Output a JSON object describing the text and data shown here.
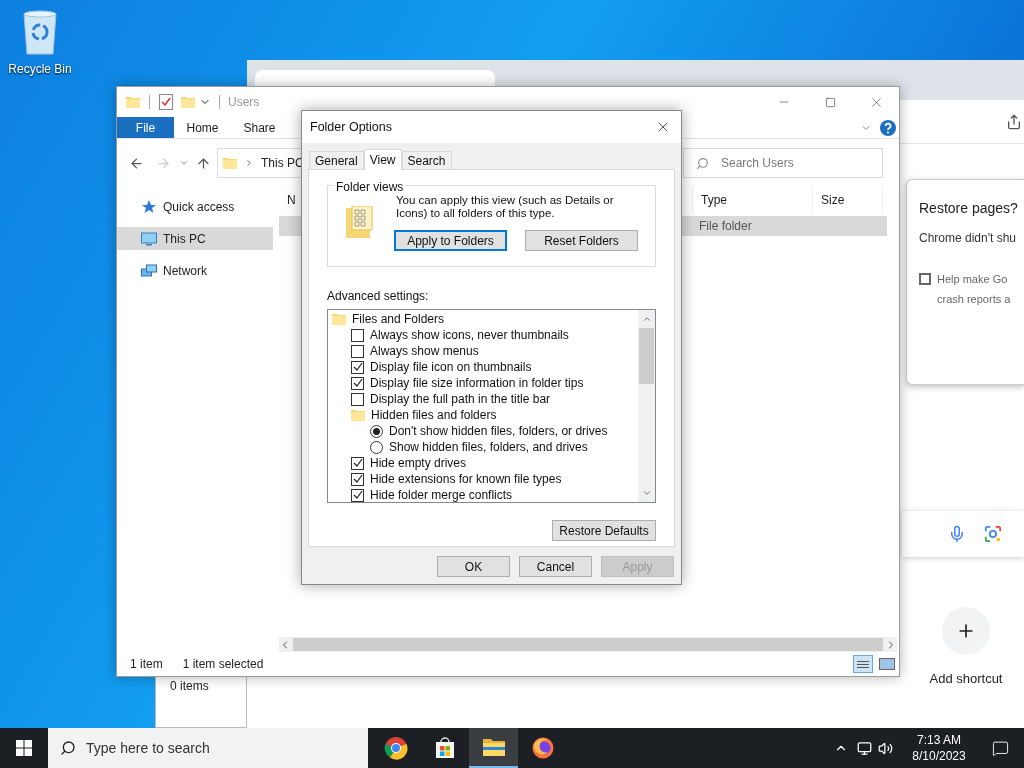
{
  "desktop": {
    "icons": [
      {
        "label": "Recycle Bin"
      }
    ]
  },
  "chrome": {
    "restore_popup": {
      "title": "Restore pages?",
      "message": "Chrome didn't shu",
      "checkbox": {
        "checked": false,
        "lines": [
          "Help make Go",
          "crash reports a"
        ]
      }
    },
    "add_shortcut": {
      "label": "Add shortcut"
    }
  },
  "back_window": {
    "status": "0 items"
  },
  "explorer": {
    "title": "Users",
    "ribbon": [
      {
        "label": "File",
        "kind": "file"
      },
      {
        "label": "Home",
        "kind": "tab"
      },
      {
        "label": "Share",
        "kind": "tab"
      }
    ],
    "address": "This PC",
    "search": {
      "placeholder": "Search Users"
    },
    "nav": [
      {
        "label": "Quick access",
        "kind": "star",
        "selected": false
      },
      {
        "label": "This PC",
        "kind": "pc",
        "selected": true
      },
      {
        "label": "Network",
        "kind": "network",
        "selected": false
      }
    ],
    "columns": [
      "N",
      "Type",
      "Size"
    ],
    "rows": [
      {
        "type": "File folder",
        "selected": true
      }
    ],
    "status": [
      "1 item",
      "1 item selected"
    ]
  },
  "dialog": {
    "title": "Folder Options",
    "tabs": [
      {
        "label": "General",
        "selected": false
      },
      {
        "label": "View",
        "selected": true
      },
      {
        "label": "Search",
        "selected": false
      }
    ],
    "folder_views": {
      "legend": "Folder views",
      "text": "You can apply this view (such as Details or Icons) to all folders of this type.",
      "buttons": [
        {
          "label": "Apply to Folders",
          "focused": true
        },
        {
          "label": "Reset Folders",
          "focused": false
        }
      ]
    },
    "advanced_label": "Advanced settings:",
    "tree": [
      {
        "kind": "folder",
        "label": "Files and Folders",
        "children": [
          {
            "kind": "checkbox",
            "label": "Always show icons, never thumbnails",
            "checked": false
          },
          {
            "kind": "checkbox",
            "label": "Always show menus",
            "checked": false
          },
          {
            "kind": "checkbox",
            "label": "Display file icon on thumbnails",
            "checked": true
          },
          {
            "kind": "checkbox",
            "label": "Display file size information in folder tips",
            "checked": true
          },
          {
            "kind": "checkbox",
            "label": "Display the full path in the title bar",
            "checked": false
          },
          {
            "kind": "folder",
            "label": "Hidden files and folders",
            "children": [
              {
                "kind": "radio",
                "label": "Don't show hidden files, folders, or drives",
                "checked": true
              },
              {
                "kind": "radio",
                "label": "Show hidden files, folders, and drives",
                "checked": false
              }
            ]
          },
          {
            "kind": "checkbox",
            "label": "Hide empty drives",
            "checked": true
          },
          {
            "kind": "checkbox",
            "label": "Hide extensions for known file types",
            "checked": true
          },
          {
            "kind": "checkbox",
            "label": "Hide folder merge conflicts",
            "checked": true
          }
        ]
      }
    ],
    "restore_button": "Restore Defaults",
    "buttons": [
      {
        "label": "OK",
        "disabled": false
      },
      {
        "label": "Cancel",
        "disabled": false
      },
      {
        "label": "Apply",
        "disabled": true
      }
    ]
  },
  "taskbar": {
    "search_placeholder": "Type here to search",
    "apps": [
      {
        "kind": "chrome",
        "active": false
      },
      {
        "kind": "store",
        "active": false
      },
      {
        "kind": "explorer",
        "active": true
      },
      {
        "kind": "firefox",
        "active": false
      }
    ],
    "time": "7:13 AM",
    "date": "8/10/2023"
  }
}
